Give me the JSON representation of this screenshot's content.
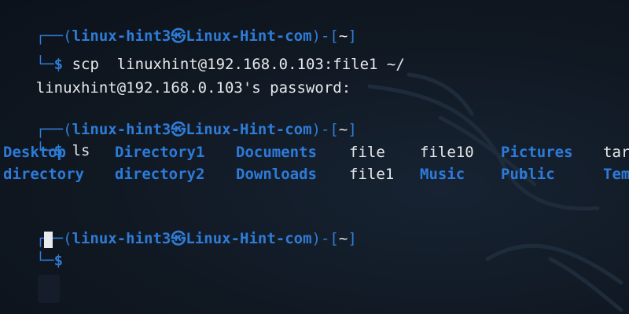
{
  "prompt": {
    "user_host": "linux-hint3",
    "at_symbol": "㉿",
    "host": "Linux-Hint-com",
    "open_bracket": ")-[",
    "cwd": "~",
    "close_bracket": "]",
    "dollar": "$"
  },
  "blocks": [
    {
      "command": "scp  linuxhint@192.168.0.103:file1 ~/",
      "output": "linuxhint@192.168.0.103's password:"
    },
    {
      "command": "ls"
    },
    {
      "command": ""
    }
  ],
  "ls_output": {
    "row1": [
      "Desktop",
      "Directory1",
      "Documents",
      "file",
      "file10",
      "Pictures",
      "tar"
    ],
    "row2": [
      "directory",
      "directory2",
      "Downloads",
      "file1",
      "Music",
      "Public",
      "Tem"
    ],
    "row1_types": [
      "dir",
      "dir",
      "dir",
      "file",
      "file",
      "dir",
      "file"
    ],
    "row2_types": [
      "dir",
      "dir",
      "dir",
      "file",
      "dir",
      "dir",
      "dir"
    ]
  },
  "colors": {
    "background": "#0f1620",
    "prompt_blue": "#2f7cd6",
    "directory_blue": "#2d7bd9",
    "text": "#e6e8ea"
  }
}
